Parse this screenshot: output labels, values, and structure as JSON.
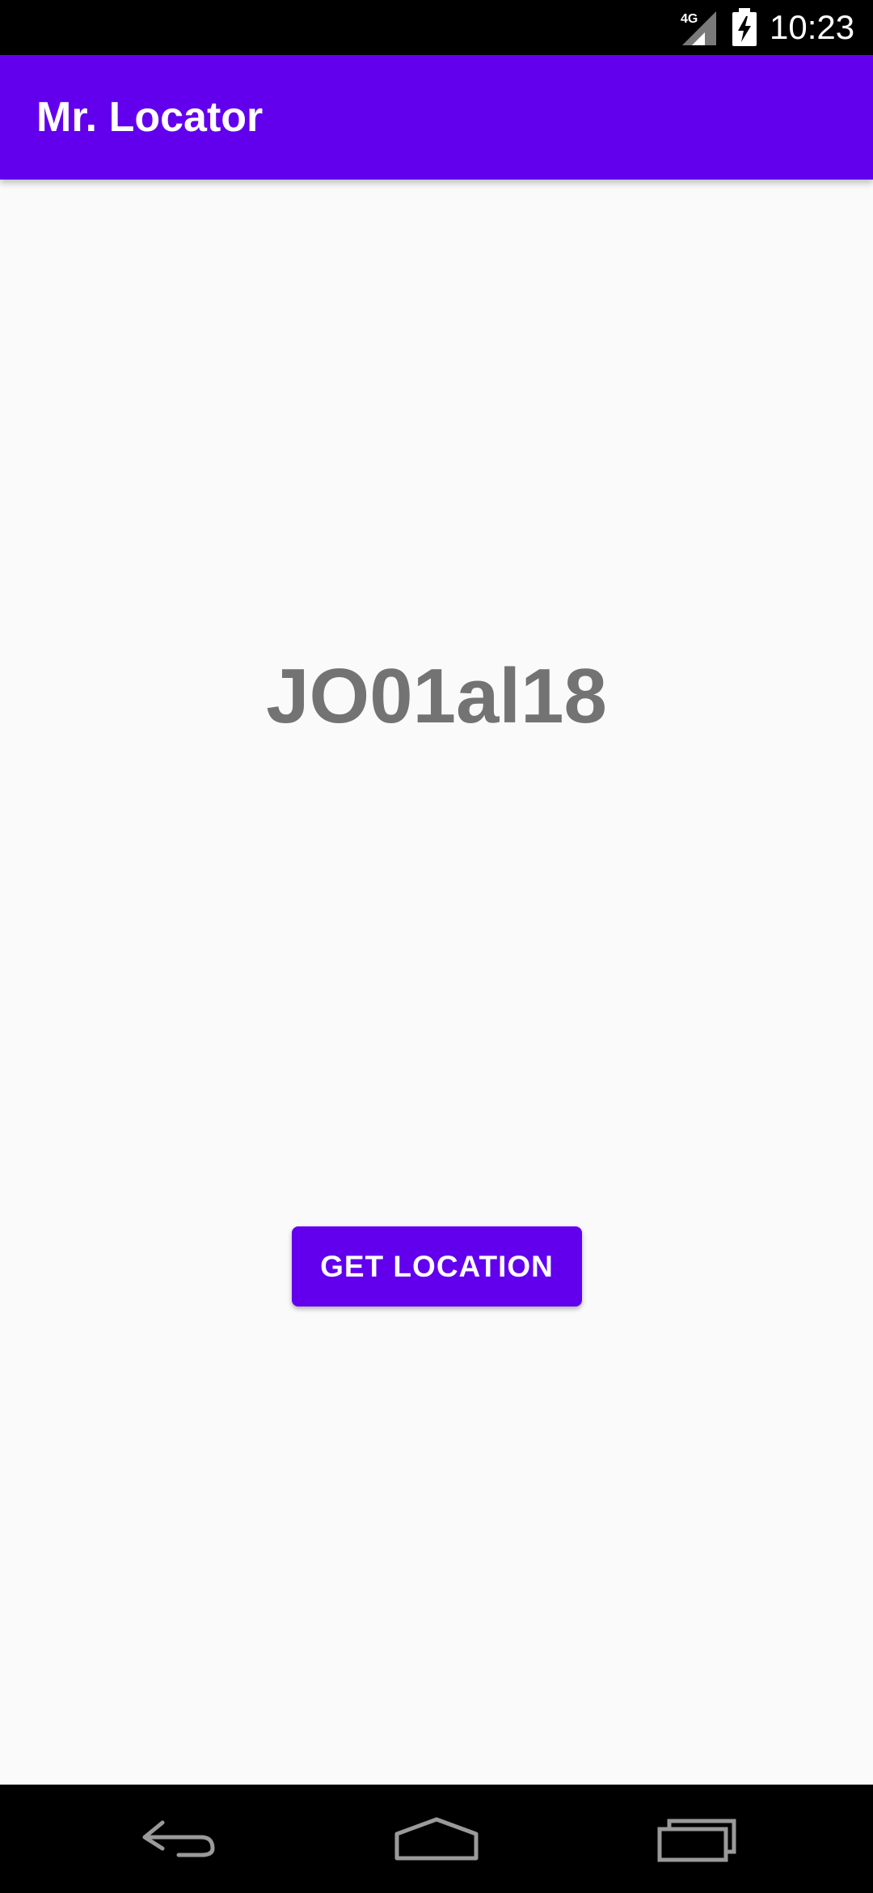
{
  "status_bar": {
    "network_type": "4G",
    "time": "10:23"
  },
  "app_bar": {
    "title": "Mr. Locator"
  },
  "main": {
    "location_code": "JO01al18",
    "get_location_button_label": "GET LOCATION"
  },
  "colors": {
    "primary": "#6200ee",
    "background": "#fafafa",
    "code_text": "#737373"
  },
  "navigation": {
    "buttons": [
      "back-icon",
      "home-icon",
      "recents-icon"
    ]
  }
}
